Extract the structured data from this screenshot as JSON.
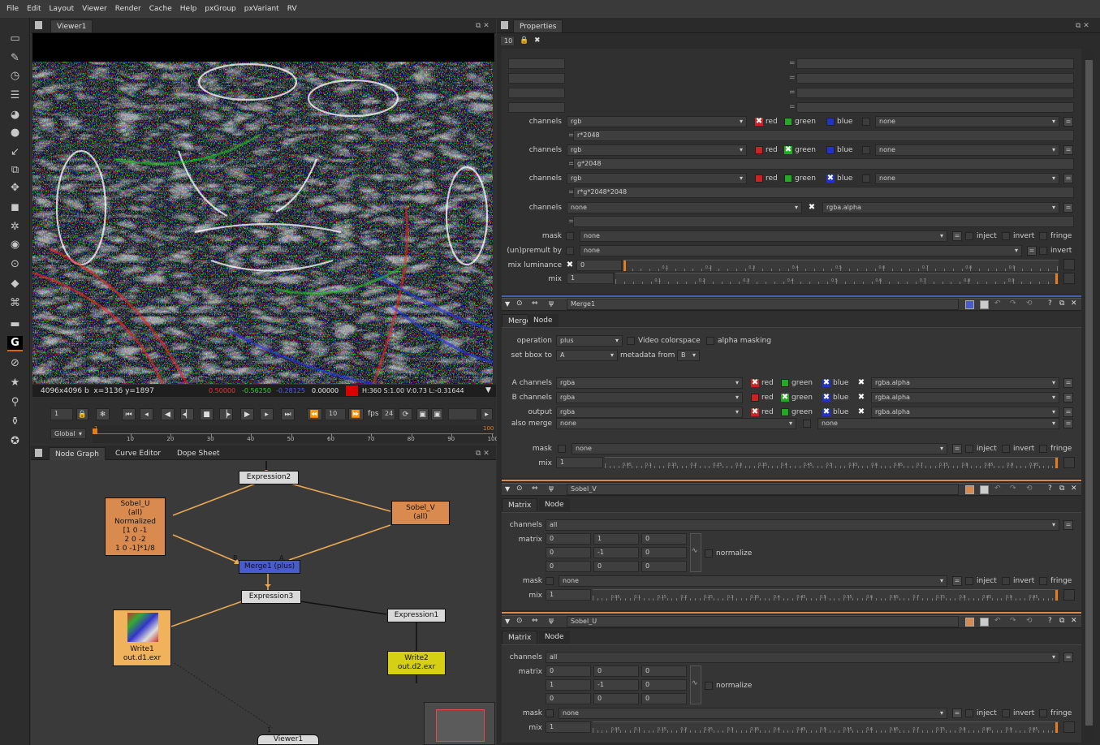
{
  "menu": [
    "File",
    "Edit",
    "Layout",
    "Viewer",
    "Render",
    "Cache",
    "Help",
    "pxGroup",
    "pxVariant",
    "RV"
  ],
  "toolbar_icons": [
    "viewer-icon",
    "pencil-icon",
    "clock-icon",
    "channel-icon",
    "color-icon",
    "filter-icon",
    "keyer-icon",
    "merge-icon",
    "transform-icon",
    "3d-icon",
    "particles-icon",
    "deep-icon",
    "views-icon",
    "metadata-icon",
    "toolsets-icon",
    "other-icon",
    "gizmo-icon",
    "ocio-icon",
    "star-icon",
    "user-icon",
    "pin-icon",
    "nuke-icon"
  ],
  "viewer": {
    "tab": "Viewer1",
    "info_left": "4096x4096 b  x=3136 y=1897",
    "info_r": "0.50000",
    "info_g": "-0.56250",
    "info_b": "-0.28125",
    "info_a": "0.00000",
    "info_hsv": "H:360 S:1.00 V:0.73  L:-0.31644",
    "frame": "1",
    "increment": "10",
    "fps_label": "fps",
    "fps": "24",
    "range_mode": "Global",
    "timeline_ticks": [
      "10",
      "20",
      "30",
      "40",
      "50",
      "60",
      "70",
      "80",
      "90",
      "100"
    ],
    "timeline_start": "1",
    "timeline_end": "100"
  },
  "graph_tabs": [
    "Node Graph",
    "Curve Editor",
    "Dope Sheet"
  ],
  "nodes": {
    "expression2": "Expression2",
    "sobel_u": [
      "Sobel_U",
      "(all)",
      "Normalized",
      "[1 0 -1",
      "2 0 -2",
      "1 0 -1]*1/8"
    ],
    "sobel_v": [
      "Sobel_V",
      "(all)"
    ],
    "merge1": "Merge1 (plus)",
    "expression3": "Expression3",
    "expression1": "Expression1",
    "write1": [
      "Write1",
      "out.d1.exr"
    ],
    "write2": [
      "Write2",
      "out.d2.exr"
    ],
    "viewer1": "Viewer1",
    "input_b": "B",
    "input_a": "A",
    "input_1": "1"
  },
  "properties": {
    "tab": "Properties",
    "max_panels": "10",
    "expression_node": {
      "rows": [
        {
          "label": "channels",
          "channel": "rgb",
          "r": "red",
          "g": "green",
          "b": "blue",
          "a": "none",
          "expr": "r*2048",
          "checked": "r"
        },
        {
          "label": "channels",
          "channel": "rgb",
          "r": "red",
          "g": "green",
          "b": "blue",
          "a": "none",
          "expr": "g*2048",
          "checked": "g"
        },
        {
          "label": "channels",
          "channel": "rgb",
          "r": "red",
          "g": "green",
          "b": "blue",
          "a": "none",
          "expr": "r*g*2048*2048",
          "checked": "b"
        }
      ],
      "alpha_row": {
        "label": "channels",
        "channel": "none",
        "alpha": "rgba.alpha"
      },
      "mask_label": "mask",
      "mask_value": "none",
      "inject": "inject",
      "invert": "invert",
      "fringe": "fringe",
      "premult_label": "(un)premult by",
      "premult_value": "none",
      "mixlum_label": "mix luminance",
      "mixlum_value": "0",
      "mix_label": "mix",
      "mix_value": "1"
    },
    "merge": {
      "name": "Merge1",
      "tabs": [
        "Merge",
        "Node"
      ],
      "operation_label": "operation",
      "operation": "plus",
      "video_colorspace": "Video colorspace",
      "alpha_masking": "alpha masking",
      "bbox_label": "set bbox to",
      "bbox": "A",
      "metadata_label": "metadata from",
      "metadata": "B",
      "a_channels_label": "A channels",
      "b_channels_label": "B channels",
      "output_label": "output",
      "channels_value": "rgba",
      "alpha_value": "rgba.alpha",
      "also_merge_label": "also merge",
      "also_merge": "none",
      "also_merge2": "none",
      "mask_label": "mask",
      "mask": "none",
      "mix_label": "mix",
      "mix": "1"
    },
    "sobel_v": {
      "name": "Sobel_V",
      "tabs": [
        "Matrix",
        "Node"
      ],
      "channels_label": "channels",
      "channels": "all",
      "matrix_label": "matrix",
      "matrix": [
        [
          "0",
          "1",
          "0"
        ],
        [
          "0",
          "-1",
          "0"
        ],
        [
          "0",
          "0",
          "0"
        ]
      ],
      "normalize": "normalize",
      "mask_label": "mask",
      "mask": "none",
      "mix_label": "mix",
      "mix": "1"
    },
    "sobel_u": {
      "name": "Sobel_U",
      "tabs": [
        "Matrix",
        "Node"
      ],
      "channels_label": "channels",
      "channels": "all",
      "matrix_label": "matrix",
      "matrix": [
        [
          "0",
          "0",
          "0"
        ],
        [
          "1",
          "-1",
          "0"
        ],
        [
          "0",
          "0",
          "0"
        ]
      ],
      "normalize": "normalize",
      "mask_label": "mask",
      "mask": "none",
      "mix_label": "mix",
      "mix": "1"
    },
    "labels": {
      "red": "red",
      "green": "green",
      "blue": "blue",
      "inject": "inject",
      "invert": "invert",
      "fringe": "fringe"
    },
    "slider_ticks_10": [
      "0.1",
      "0.2",
      "0.3",
      "0.4",
      "0.5",
      "0.6",
      "0.7",
      "0.8",
      "0.9"
    ],
    "slider_ticks_20": [
      "0.05",
      "0.1",
      "0.15",
      "0.2",
      "0.25",
      "0.3",
      "0.35",
      "0.4",
      "0.45",
      "0.5",
      "0.55",
      "0.6",
      "0.65",
      "0.7",
      "0.75",
      "0.8",
      "0.85",
      "0.9",
      "0.95"
    ]
  },
  "colors": {
    "expression_node": "#d9d9d9",
    "sobel_node": "#d98a4e",
    "merge_node": "#4a5ccc",
    "write1_node": "#f0b25a",
    "write2_node": "#d6cf14",
    "link": "#e9a853"
  }
}
